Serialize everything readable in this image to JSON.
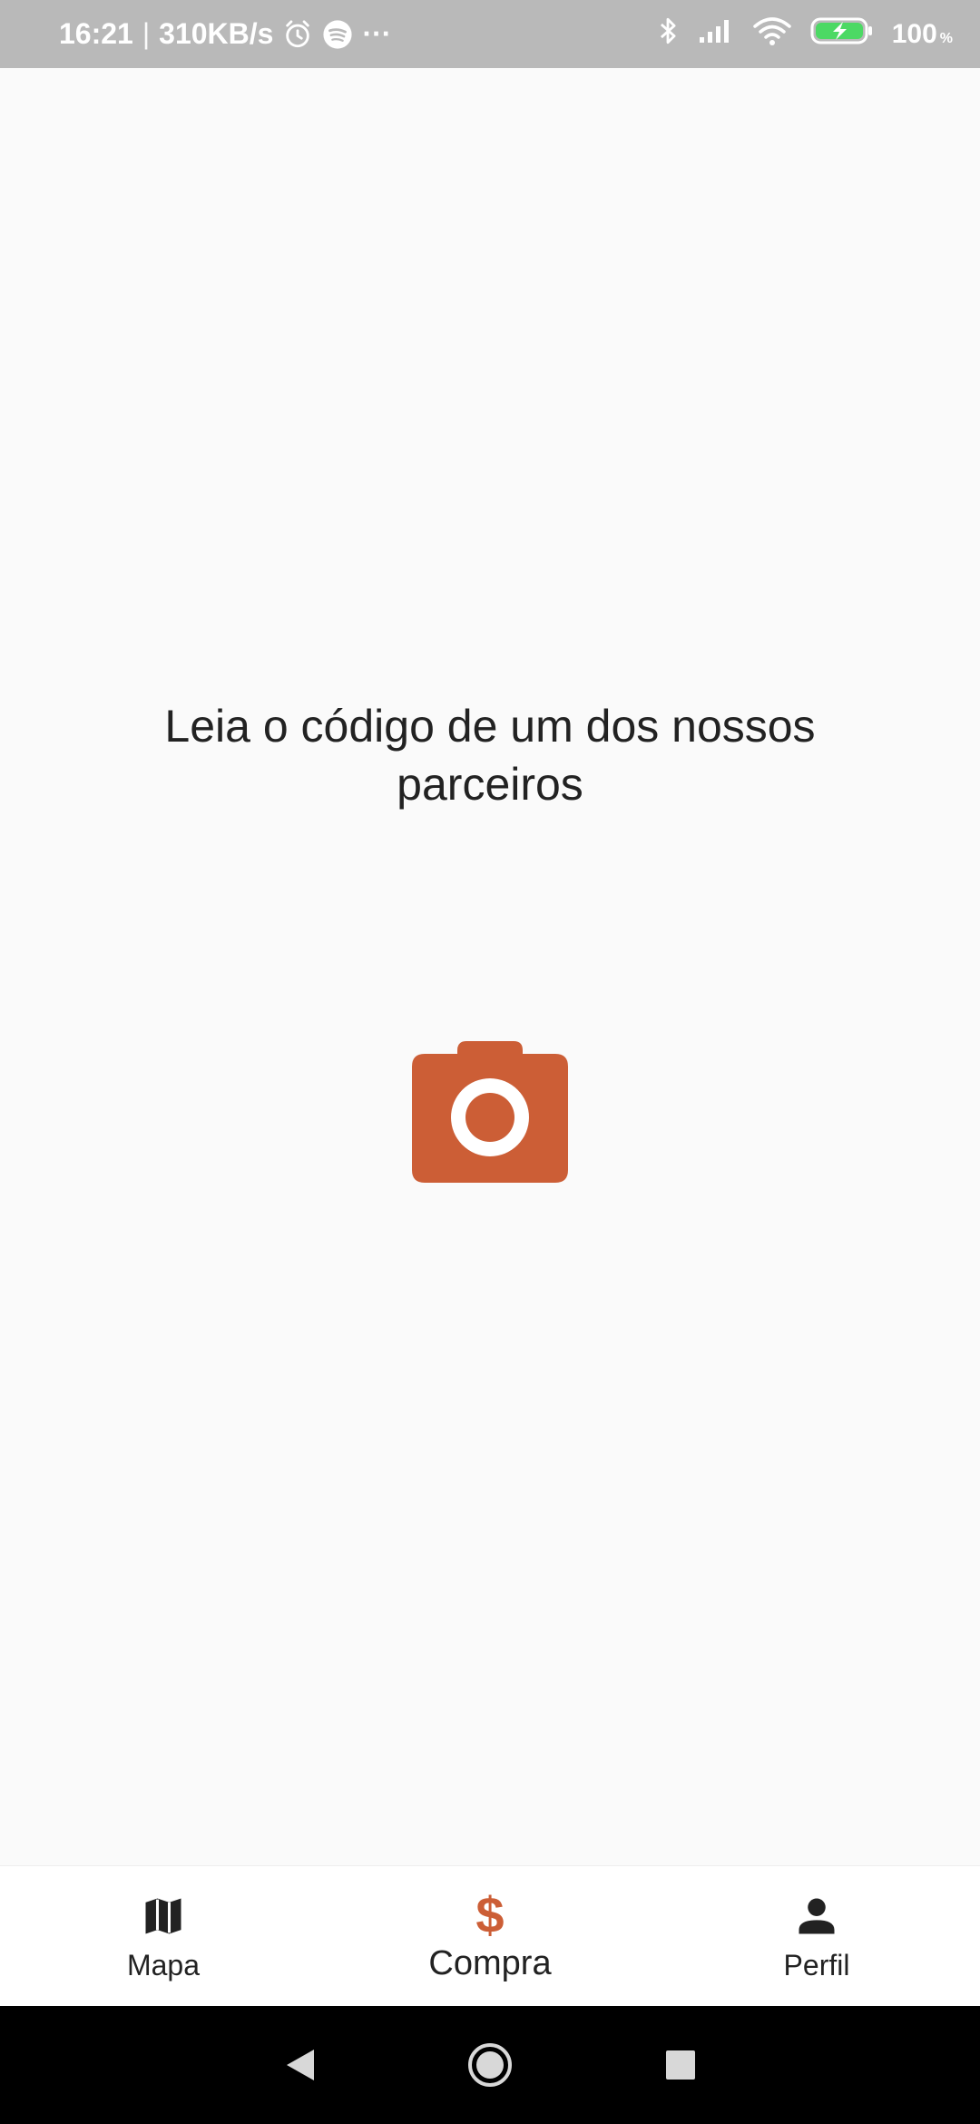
{
  "colors": {
    "accent": "#CC5E36",
    "background": "#FAFAFA",
    "status_bar": "#B9B9B9",
    "text": "#222222",
    "battery_fill": "#4CD964"
  },
  "status_bar": {
    "time": "16:21",
    "separator": "|",
    "speed": "310KB/s",
    "more": "···",
    "battery_percent": "100",
    "battery_percent_sign": "%",
    "icons": [
      "alarm-icon",
      "spotify-icon",
      "bluetooth-icon",
      "signal-icon",
      "wifi-icon",
      "battery-charging-icon"
    ]
  },
  "main": {
    "instruction": "Leia o código de um dos nossos parceiros",
    "camera_icon": "camera-icon"
  },
  "bottom_nav": {
    "items": [
      {
        "label": "Mapa",
        "icon": "map-icon",
        "active": false
      },
      {
        "label": "Compra",
        "icon": "dollar-icon",
        "active": true,
        "glyph": "$"
      },
      {
        "label": "Perfil",
        "icon": "person-icon",
        "active": false
      }
    ]
  },
  "system_nav": {
    "icons": [
      "back-icon",
      "home-icon",
      "recents-icon"
    ]
  }
}
